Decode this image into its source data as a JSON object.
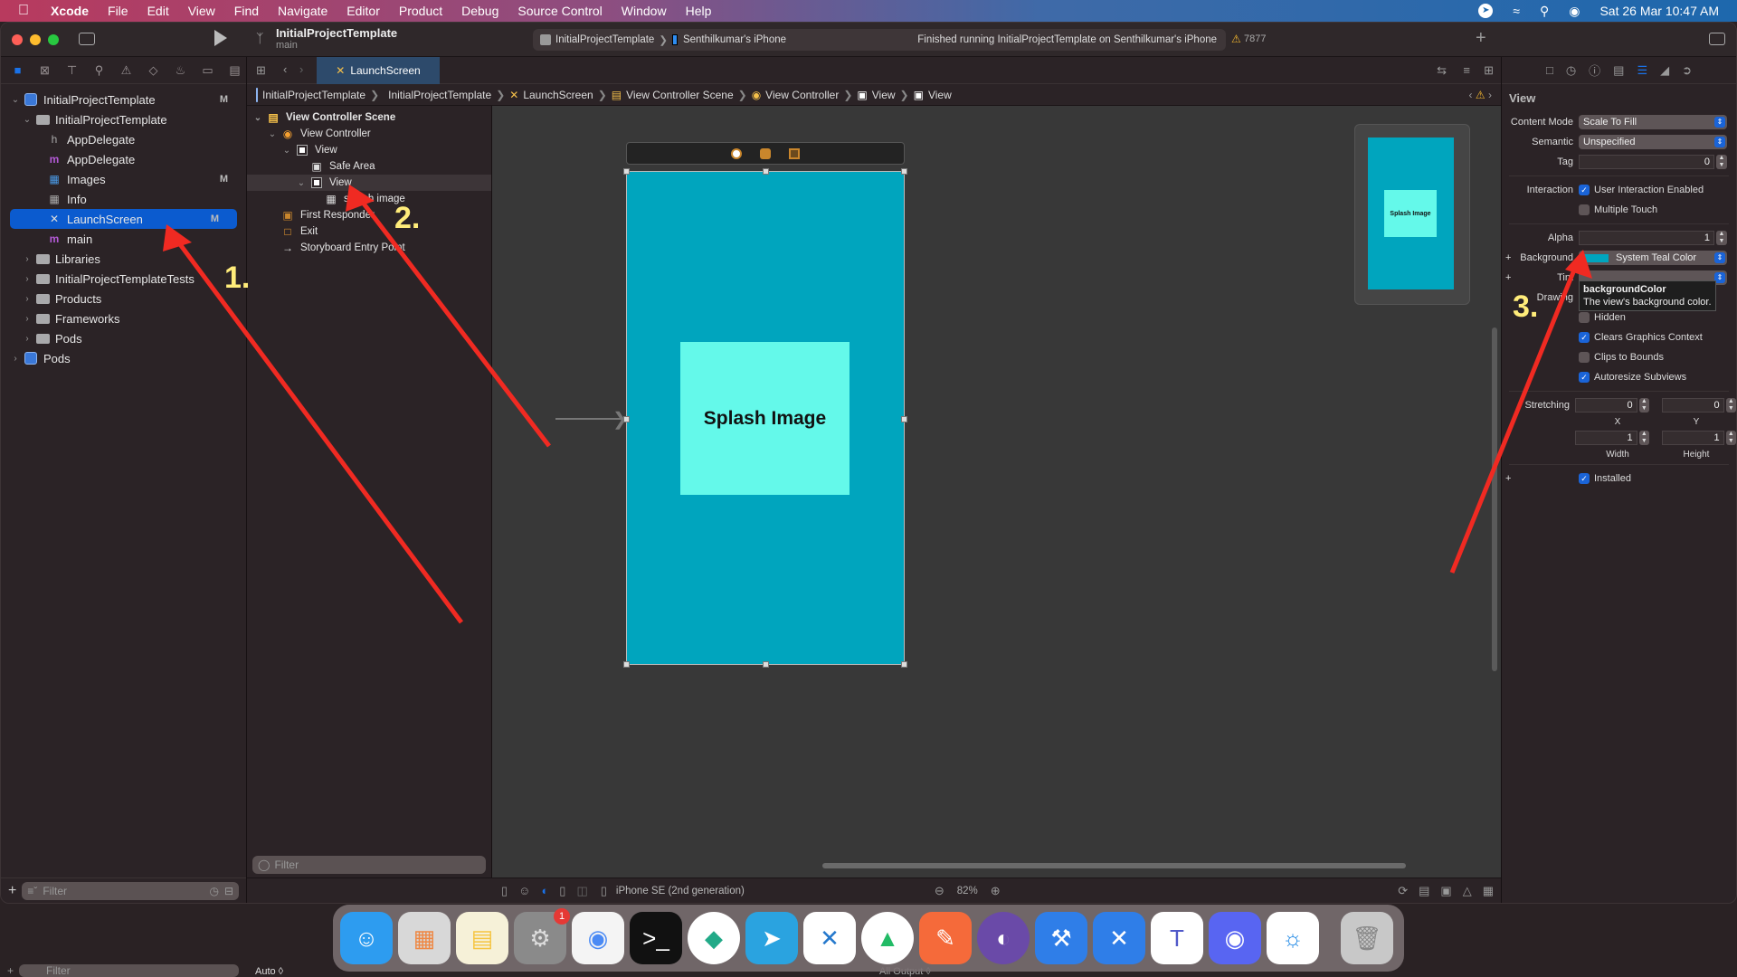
{
  "menubar": {
    "app": "Xcode",
    "items": [
      "File",
      "Edit",
      "View",
      "Find",
      "Navigate",
      "Editor",
      "Product",
      "Debug",
      "Source Control",
      "Window",
      "Help"
    ],
    "datetime": "Sat 26 Mar  10:47 AM"
  },
  "toolbar": {
    "project": "InitialProjectTemplate",
    "branch": "main",
    "scheme": "InitialProjectTemplate",
    "device": "Senthilkumar's iPhone",
    "status": "Finished running InitialProjectTemplate on Senthilkumar's iPhone",
    "warnings": "7877"
  },
  "navigator": {
    "tree": [
      {
        "label": "InitialProjectTemplate",
        "badge": "M",
        "icon": "project",
        "indent": 0,
        "chev": "v"
      },
      {
        "label": "InitialProjectTemplate",
        "badge": "",
        "icon": "folder",
        "indent": 1,
        "chev": "v"
      },
      {
        "label": "AppDelegate",
        "badge": "",
        "icon": "h",
        "indent": 2,
        "chev": ""
      },
      {
        "label": "AppDelegate",
        "badge": "",
        "icon": "m",
        "indent": 2,
        "chev": ""
      },
      {
        "label": "Images",
        "badge": "M",
        "icon": "assets",
        "indent": 2,
        "chev": ""
      },
      {
        "label": "Info",
        "badge": "",
        "icon": "plist",
        "indent": 2,
        "chev": ""
      },
      {
        "label": "LaunchScreen",
        "badge": "M",
        "icon": "storyboard",
        "indent": 2,
        "chev": "",
        "selected": true
      },
      {
        "label": "main",
        "badge": "",
        "icon": "m",
        "indent": 2,
        "chev": ""
      },
      {
        "label": "Libraries",
        "badge": "",
        "icon": "folder",
        "indent": 1,
        "chev": ">"
      },
      {
        "label": "InitialProjectTemplateTests",
        "badge": "",
        "icon": "folder",
        "indent": 1,
        "chev": ">"
      },
      {
        "label": "Products",
        "badge": "",
        "icon": "folder",
        "indent": 1,
        "chev": ">"
      },
      {
        "label": "Frameworks",
        "badge": "",
        "icon": "folder",
        "indent": 1,
        "chev": ">"
      },
      {
        "label": "Pods",
        "badge": "",
        "icon": "folder",
        "indent": 1,
        "chev": ">"
      },
      {
        "label": "Pods",
        "badge": "",
        "icon": "project",
        "indent": 0,
        "chev": ">"
      }
    ],
    "filter_placeholder": "Filter"
  },
  "editor": {
    "tab": "LaunchScreen",
    "jumpbar": [
      "InitialProjectTemplate",
      "InitialProjectTemplate",
      "LaunchScreen",
      "View Controller Scene",
      "View Controller",
      "View",
      "View"
    ],
    "outline": [
      {
        "label": "View Controller Scene",
        "indent": 0,
        "chev": "v",
        "icon": "scene",
        "bold": true
      },
      {
        "label": "View Controller",
        "indent": 1,
        "chev": "v",
        "icon": "vc"
      },
      {
        "label": "View",
        "indent": 2,
        "chev": "v",
        "icon": "view"
      },
      {
        "label": "Safe Area",
        "indent": 3,
        "chev": "",
        "icon": "safe"
      },
      {
        "label": "View",
        "indent": 3,
        "chev": "v",
        "icon": "view",
        "selected": true
      },
      {
        "label": "splash image",
        "indent": 4,
        "chev": "",
        "icon": "image"
      },
      {
        "label": "First Responder",
        "indent": 1,
        "chev": "",
        "icon": "responder"
      },
      {
        "label": "Exit",
        "indent": 1,
        "chev": "",
        "icon": "exit"
      },
      {
        "label": "Storyboard Entry Point",
        "indent": 1,
        "chev": "",
        "icon": "arrow"
      }
    ],
    "outline_filter_placeholder": "Filter",
    "canvas": {
      "splash_label": "Splash Image",
      "minimap_label": "Splash Image",
      "bg_color": "#00a5be",
      "splash_color": "#64f9ea"
    },
    "device": "iPhone SE (2nd generation)",
    "zoom": "82%"
  },
  "inspector": {
    "title": "View",
    "content_mode_label": "Content Mode",
    "content_mode": "Scale To Fill",
    "semantic_label": "Semantic",
    "semantic": "Unspecified",
    "tag_label": "Tag",
    "tag": "0",
    "interaction_label": "Interaction",
    "user_interaction": "User Interaction Enabled",
    "multiple_touch": "Multiple Touch",
    "alpha_label": "Alpha",
    "alpha": "1",
    "background_label": "Background",
    "background": "System Teal Color",
    "tint_label": "Tint",
    "drawing_label": "Drawing",
    "hidden": "Hidden",
    "clears": "Clears Graphics Context",
    "clips": "Clips to Bounds",
    "autoresize": "Autoresize Subviews",
    "stretching_label": "Stretching",
    "stretch_x": "0",
    "stretch_y": "0",
    "stretch_w": "1",
    "stretch_h": "1",
    "x_label": "X",
    "y_label": "Y",
    "w_label": "Width",
    "h_label": "Height",
    "installed": "Installed",
    "tooltip_title": "backgroundColor",
    "tooltip_text": "The view's background color."
  },
  "annotations": [
    "1.",
    "2.",
    "3."
  ],
  "dock": {
    "apps": [
      "Finder",
      "Launchpad",
      "Notes",
      "System Preferences",
      "Chrome",
      "Terminal",
      "Sourcetree",
      "Telegram",
      "VS Code",
      "Android Studio",
      "Postman",
      "Cinema",
      "Xcode",
      "Transporter",
      "Teams",
      "Discord",
      "Safari",
      "Trash"
    ],
    "settings_badge": "1"
  },
  "debug": {
    "auto_label": "Auto ◊",
    "filter": "Filter",
    "output": "All Output ◊"
  }
}
